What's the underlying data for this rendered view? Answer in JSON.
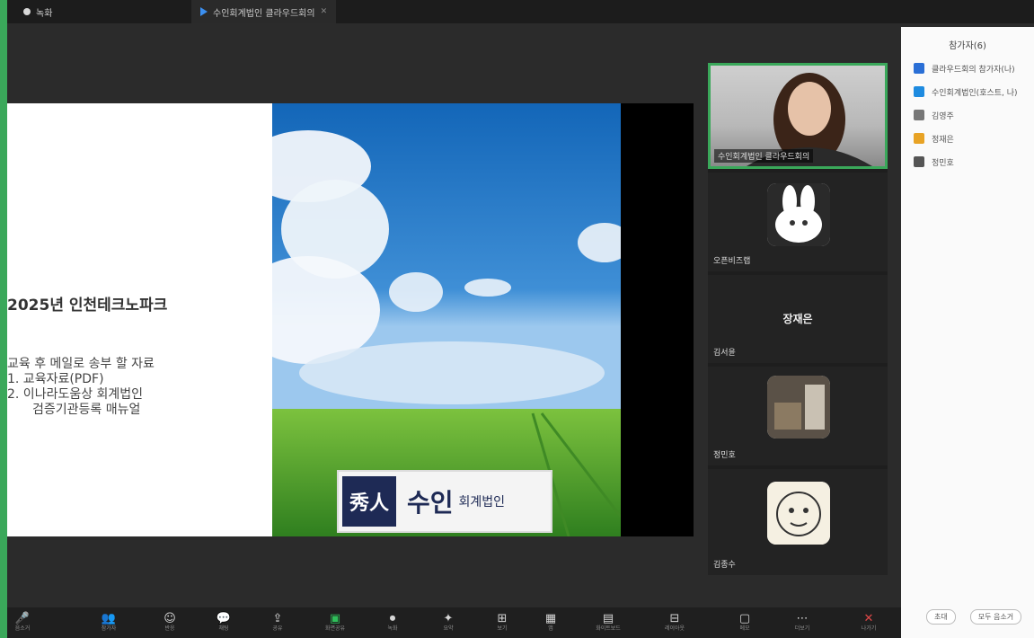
{
  "tabs": [
    {
      "label": "녹화"
    },
    {
      "label": "수인회계법인 클라우드회의"
    }
  ],
  "slide": {
    "title": "2025년 인천테크노파크",
    "body_lines": [
      "교육 후 메일로 송부 할 자료",
      "1.  교육자료(PDF)",
      "2.  이나라도움상 회계법인",
      "검증기관등록 매뉴얼"
    ],
    "logo_mark": "秀人",
    "logo_name": "수인",
    "logo_sub": "회계법인"
  },
  "participants": [
    {
      "name": "수인회계법인 클라우드회의",
      "kind": "video"
    },
    {
      "name": "오픈비즈랩",
      "kind": "avatar"
    },
    {
      "name": "김서윤",
      "kind": "name",
      "display": "장재은"
    },
    {
      "name": "정민호",
      "kind": "avatar"
    },
    {
      "name": "김종수",
      "kind": "avatar"
    }
  ],
  "chat": {
    "title": "참가자(6)",
    "entries": [
      {
        "text": "클라우드회의 참가자(나)",
        "icon_color": "#2a6fd6"
      },
      {
        "text": "수인회계법인(호스트, 나)",
        "icon_color": "#1e8be0"
      },
      {
        "text": "김영주",
        "icon_color": "#777777"
      },
      {
        "text": "정재은",
        "icon_color": "#e8a325"
      },
      {
        "text": "정민호",
        "icon_color": "#555555"
      }
    ],
    "buttons": [
      "초대",
      "모두 음소거"
    ]
  },
  "toolbar": {
    "items": [
      {
        "label": "음소거",
        "icon": "mic-icon",
        "glyph": "🎤"
      },
      {
        "label": "참가자",
        "icon": "people-icon",
        "glyph": "👥"
      },
      {
        "label": "반응",
        "icon": "reaction-icon",
        "glyph": "☺"
      },
      {
        "label": "채팅",
        "icon": "chat-icon",
        "glyph": "💬"
      },
      {
        "label": "공유",
        "icon": "share-icon",
        "glyph": "⇪"
      },
      {
        "label": "화면공유",
        "icon": "screen-share-icon",
        "glyph": "▣"
      },
      {
        "label": "녹화",
        "icon": "record-icon",
        "glyph": "⏺"
      },
      {
        "label": "요약",
        "icon": "summary-icon",
        "glyph": "✦"
      },
      {
        "label": "보기",
        "icon": "view-icon",
        "glyph": "⊞"
      },
      {
        "label": "앱",
        "icon": "apps-icon",
        "glyph": "▦"
      },
      {
        "label": "화이트보드",
        "icon": "whiteboard-icon",
        "glyph": "▤"
      },
      {
        "label": "레이아웃",
        "icon": "layout-icon",
        "glyph": "⊟"
      },
      {
        "label": "메모",
        "icon": "notes-icon",
        "glyph": "▢"
      },
      {
        "label": "더보기",
        "icon": "more-icon",
        "glyph": "⋯"
      },
      {
        "label": "나가기",
        "icon": "leave-icon",
        "glyph": "✕"
      }
    ]
  }
}
